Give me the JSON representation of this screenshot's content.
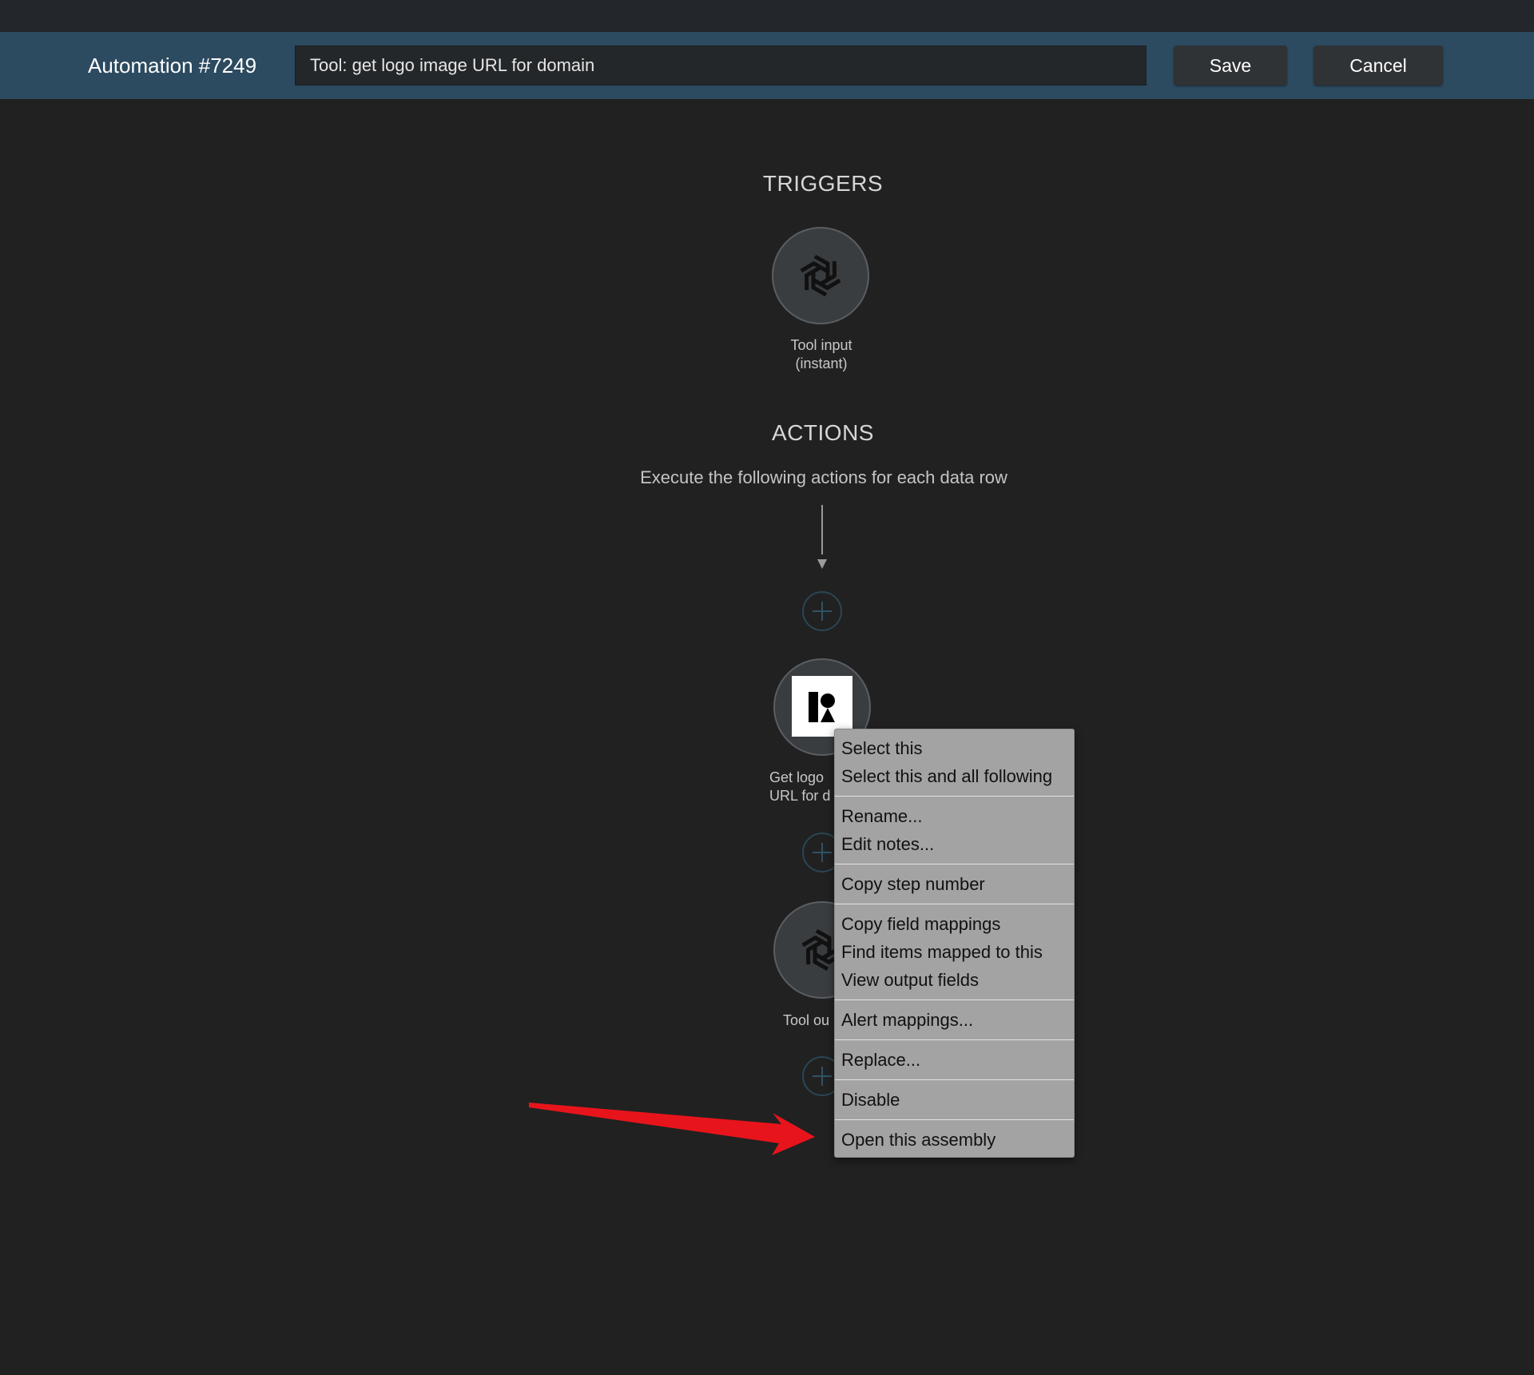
{
  "header": {
    "title": "Automation #7249",
    "name_value": "Tool: get logo image URL for domain",
    "save_label": "Save",
    "cancel_label": "Cancel"
  },
  "triggers": {
    "title": "TRIGGERS",
    "node": {
      "icon": "openai-icon",
      "label_line1": "Tool input",
      "label_line2": "(instant)"
    }
  },
  "actions": {
    "title": "ACTIONS",
    "subtitle": "Execute the following actions for each data row",
    "steps": [
      {
        "icon": "logo-app-icon",
        "label_line1": "Get logo",
        "label_line2": "URL for d"
      },
      {
        "icon": "openai-icon",
        "label_line1": "Tool ou"
      }
    ]
  },
  "context_menu": {
    "groups": [
      [
        "Select this",
        "Select this and all following"
      ],
      [
        "Rename...",
        "Edit notes..."
      ],
      [
        "Copy step number"
      ],
      [
        "Copy field mappings",
        "Find items mapped to this",
        "View output fields"
      ],
      [
        "Alert mappings..."
      ],
      [
        "Replace..."
      ],
      [
        "Disable"
      ],
      [
        "Open this assembly"
      ]
    ]
  },
  "colors": {
    "header_bg": "#2c4a60",
    "canvas_bg": "#212121",
    "menu_bg": "#a3a3a3",
    "annotation_arrow": "#e8141b"
  }
}
